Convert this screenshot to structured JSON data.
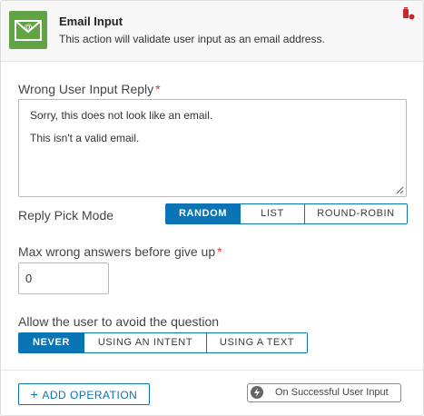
{
  "header": {
    "icon": "email-envelope-icon",
    "title": "Email Input",
    "subtitle": "This action will validate user input as an email address."
  },
  "wrong_reply": {
    "label": "Wrong User Input Reply",
    "required_marker": "*",
    "lines": [
      "Sorry, this does not look like an email.",
      "This isn't a valid email."
    ]
  },
  "pick_mode": {
    "label": "Reply Pick Mode",
    "options": [
      "RANDOM",
      "LIST",
      "ROUND-ROBIN"
    ],
    "selected": "RANDOM"
  },
  "max_wrong": {
    "label": "Max wrong answers before give up",
    "required_marker": "*",
    "value": "0"
  },
  "avoid": {
    "label": "Allow the user to avoid the question",
    "options": [
      "NEVER",
      "USING AN INTENT",
      "USING A TEXT"
    ],
    "selected": "NEVER"
  },
  "footer": {
    "add_operation": "ADD OPERATION",
    "success": "On Successful User Input"
  },
  "colors": {
    "accent": "#0a74b4",
    "icon_green": "#62a444",
    "required": "#d93b3b",
    "delete_icon": "#c62828"
  }
}
